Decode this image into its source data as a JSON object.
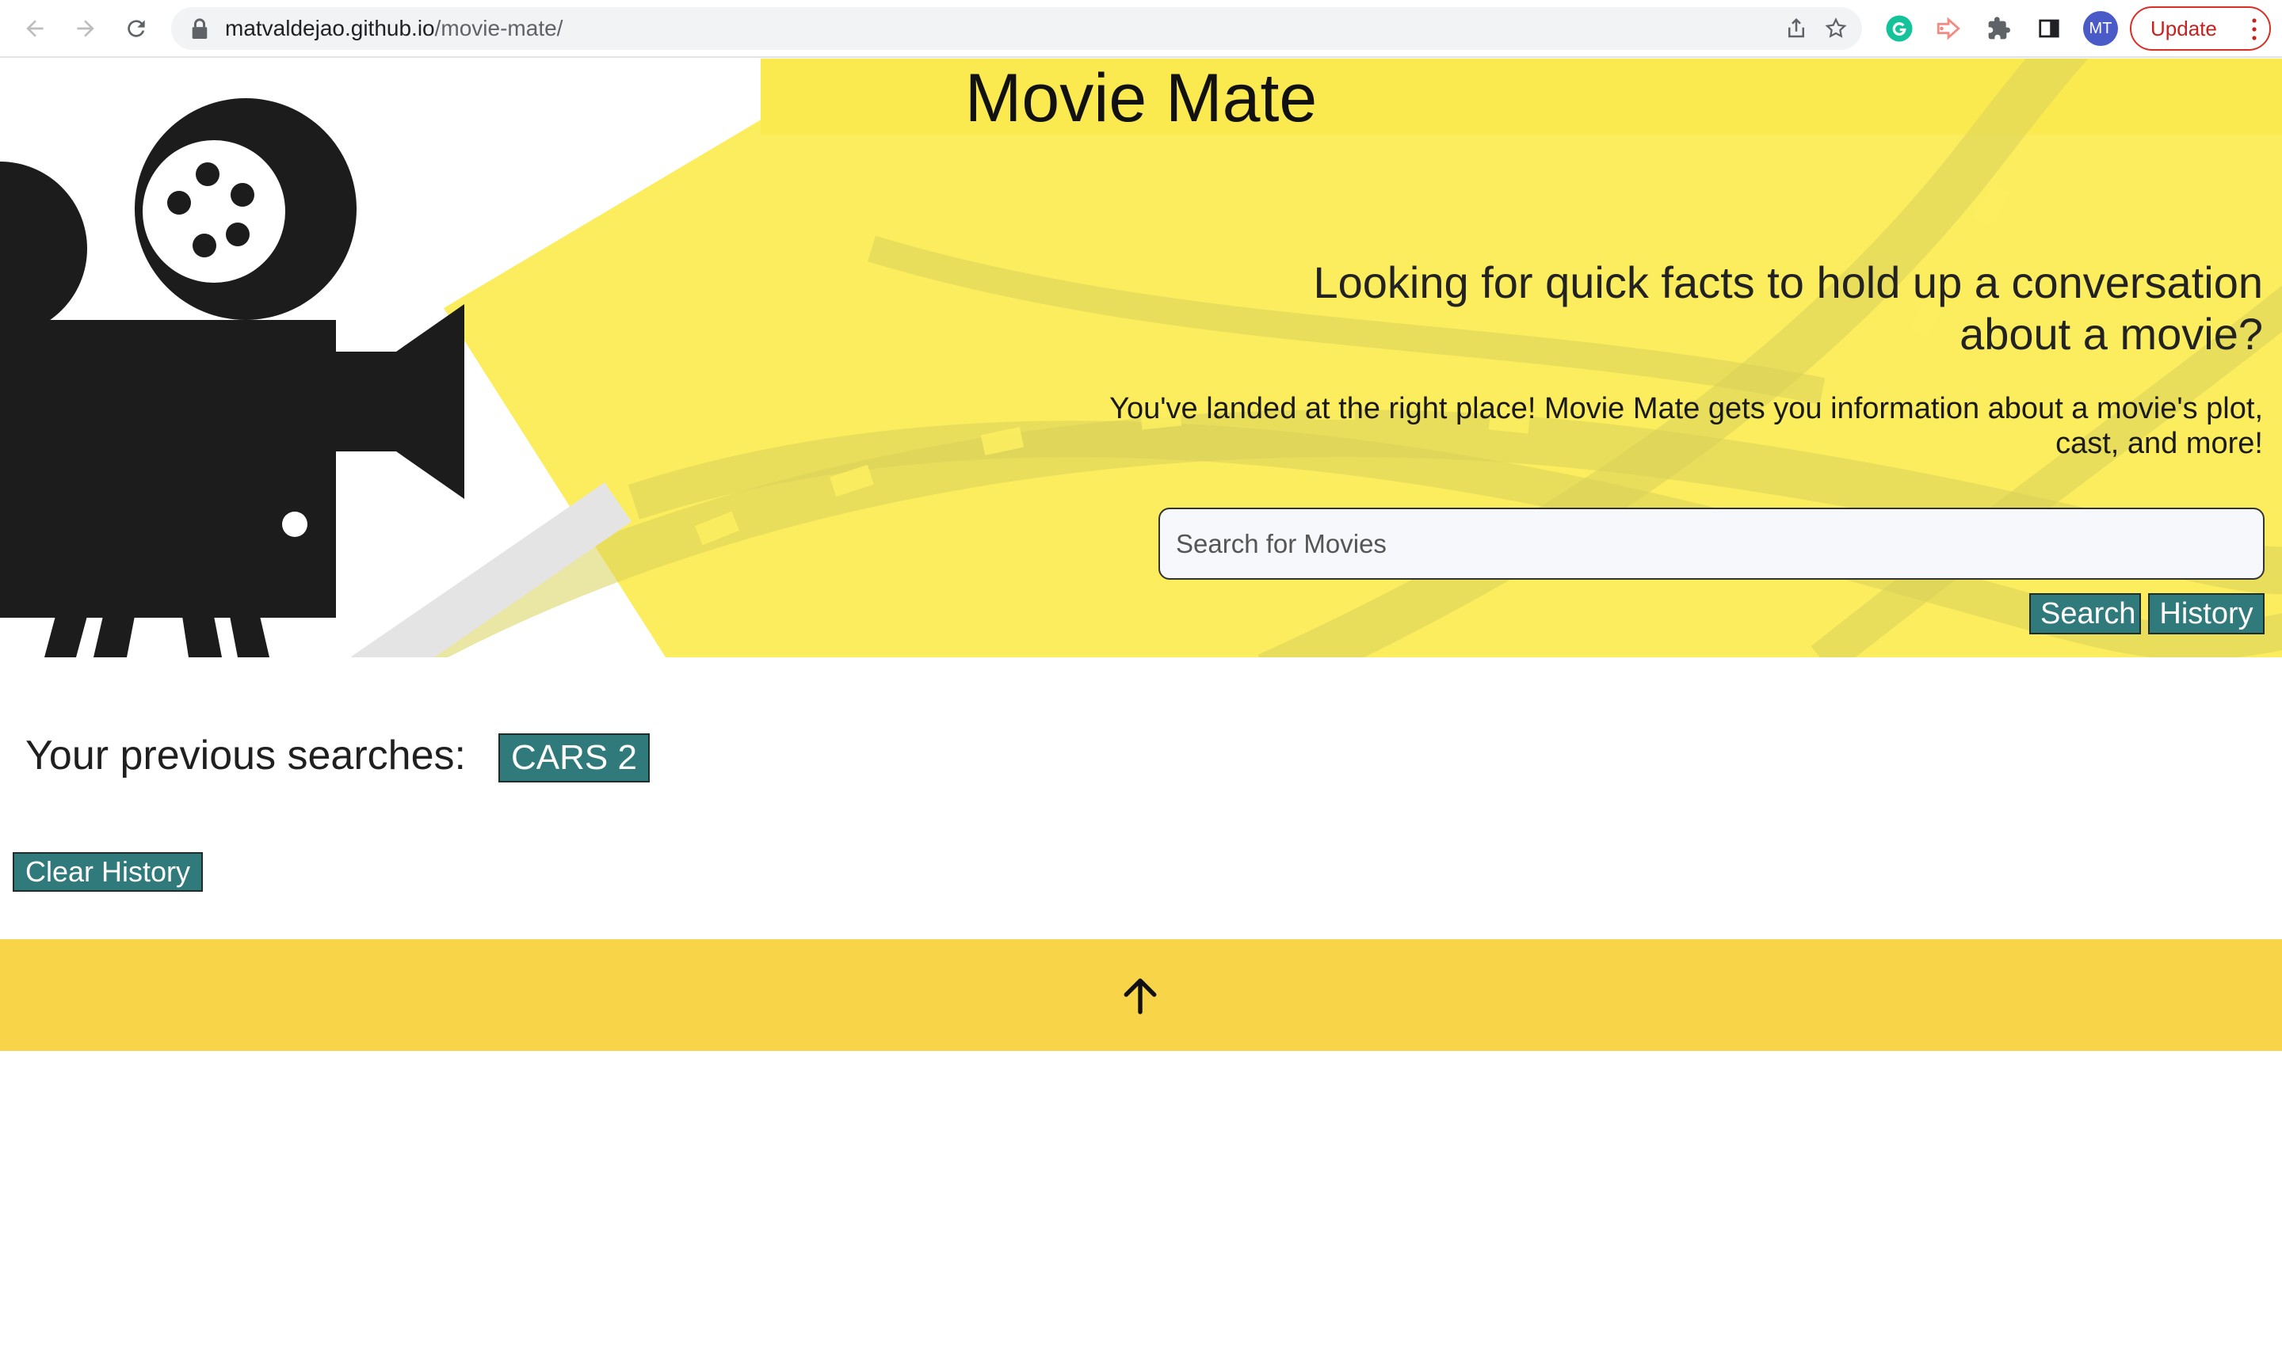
{
  "browser": {
    "url_host": "matvaldejao.github.io",
    "url_path": "/movie-mate/",
    "profile_initials": "MT",
    "update_label": "Update"
  },
  "site": {
    "title": "Movie Mate",
    "headline": "Looking for quick facts to hold up a conversation about a movie?",
    "subline": "You've landed at the right place! Movie Mate gets you information about a movie's plot, cast, and more!",
    "search": {
      "placeholder": "Search for Movies",
      "value": ""
    },
    "buttons": {
      "search_label": "Search",
      "history_label": "History",
      "clear_history_label": "Clear History"
    }
  },
  "history": {
    "label": "Your previous searches:",
    "items": [
      "CARS 2"
    ]
  },
  "colors": {
    "accent_teal": "#317a7c",
    "hero_yellow": "#fced5f",
    "footer_yellow": "#f8d548",
    "update_red": "#d93025"
  },
  "icons": [
    "back-arrow-icon",
    "forward-arrow-icon",
    "reload-icon",
    "lock-icon",
    "share-icon",
    "bookmark-star-icon",
    "grammarly-icon",
    "extension-arrow-icon",
    "puzzle-extensions-icon",
    "side-panel-icon",
    "kebab-menu-icon",
    "movie-camera-icon",
    "film-strip-icon",
    "arrow-up-icon"
  ]
}
